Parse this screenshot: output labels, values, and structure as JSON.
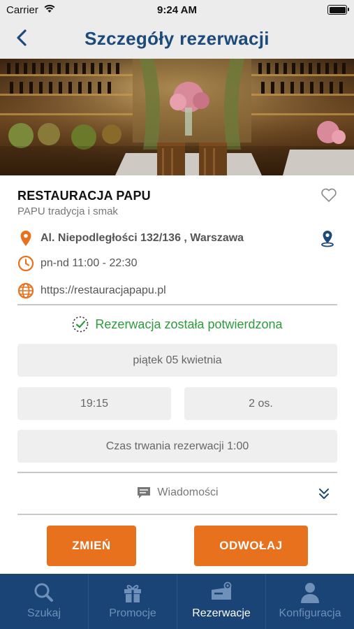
{
  "status_bar": {
    "carrier": "Carrier",
    "time": "9:24 AM"
  },
  "header": {
    "title": "Szczegóły rezerwacji"
  },
  "restaurant": {
    "name": "RESTAURACJA PAPU",
    "subtitle": "PAPU tradycja i smak",
    "address": "Al. Niepodległości  132/136 , Warszawa",
    "hours": "pn-nd 11:00 - 22:30",
    "website": "https://restauracjapapu.pl"
  },
  "reservation": {
    "status": "Rezerwacja została potwierdzona",
    "date": "piątek 05 kwietnia",
    "time": "19:15",
    "guests": "2 os.",
    "duration": "Czas trwania rezerwacji 1:00",
    "messages_label": "Wiadomości"
  },
  "actions": {
    "change": "ZMIEŃ",
    "cancel": "ODWOŁAJ"
  },
  "tabs": [
    {
      "label": "Szukaj",
      "icon": "search-icon",
      "active": false
    },
    {
      "label": "Promocje",
      "icon": "gift-icon",
      "active": false
    },
    {
      "label": "Rezerwacje",
      "icon": "reservation-icon",
      "active": true
    },
    {
      "label": "Konfiguracja",
      "icon": "user-icon",
      "active": false
    }
  ],
  "colors": {
    "accent": "#e8711e",
    "nav_blue": "#1c4a7a",
    "tabbar": "#1a4476",
    "confirmed_green": "#2e9a3e"
  }
}
